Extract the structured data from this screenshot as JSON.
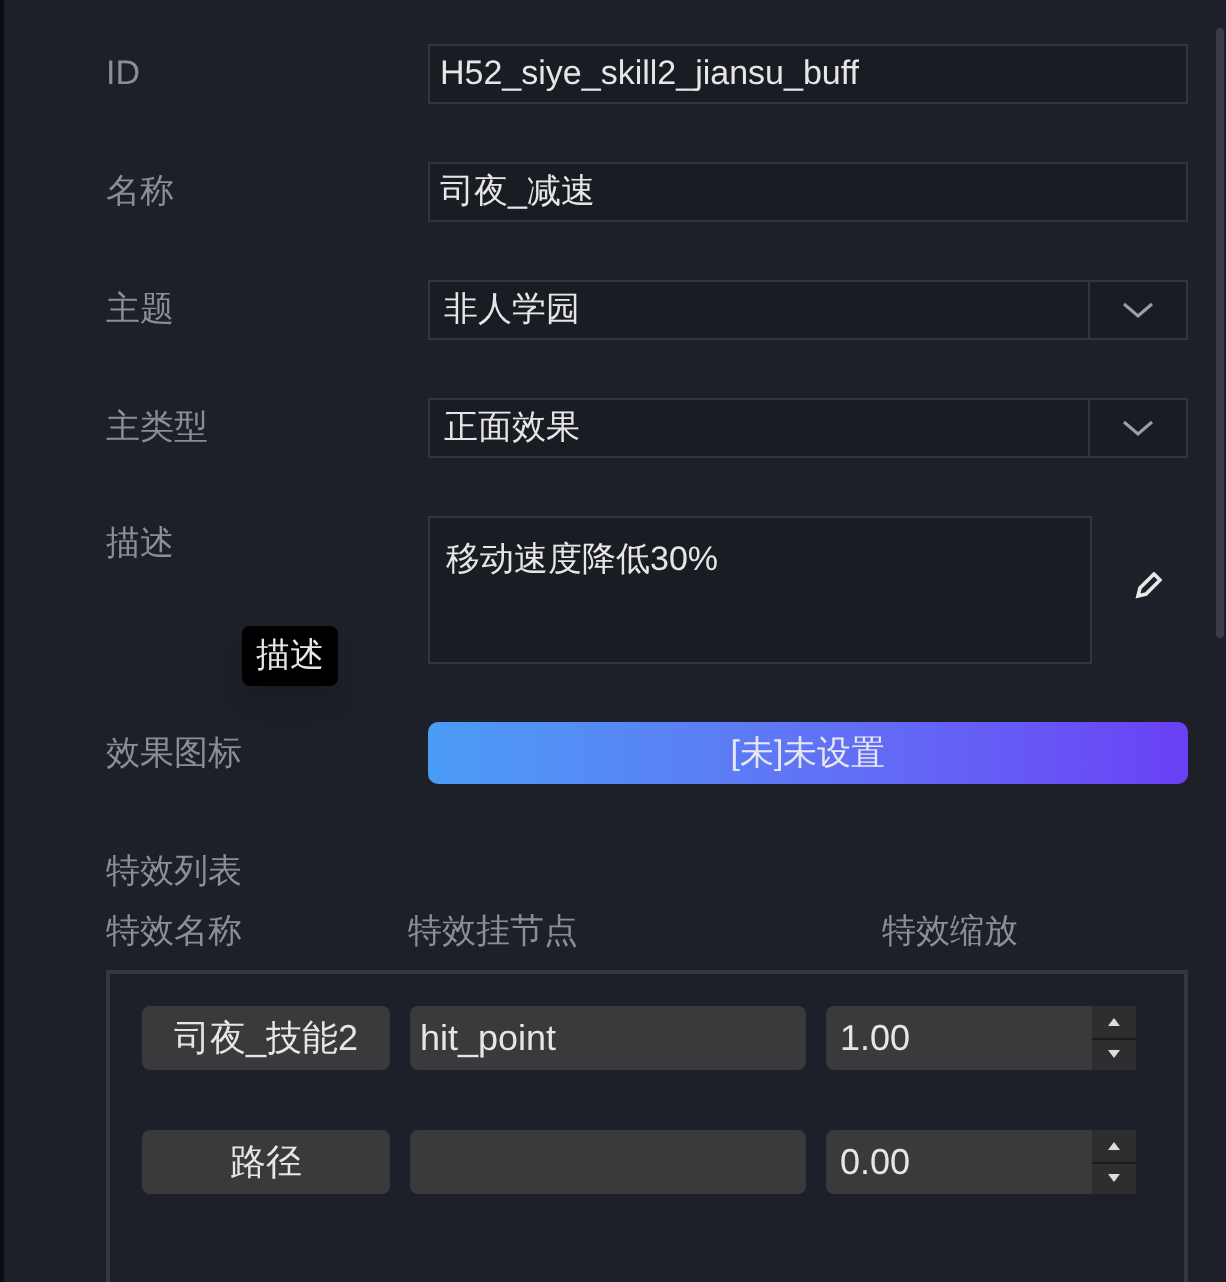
{
  "fields": [
    {
      "kind": "text",
      "label": "ID",
      "value": "H52_siye_skill2_jiansu_buff"
    },
    {
      "kind": "text",
      "label": "名称",
      "value": "司夜_减速"
    },
    {
      "kind": "select",
      "label": "主题",
      "value": "非人学园"
    },
    {
      "kind": "select",
      "label": "主类型",
      "value": "正面效果"
    },
    {
      "kind": "textarea",
      "label": "描述",
      "value": "移动速度降低30%",
      "tooltip": "描述"
    },
    {
      "kind": "picker",
      "label": "效果图标",
      "value": "[未]未设置"
    }
  ],
  "effects": {
    "title": "特效列表",
    "columns": [
      "特效名称",
      "特效挂节点",
      "特效缩放"
    ],
    "rows": [
      {
        "name": "司夜_技能2",
        "node": "hit_point",
        "scale": "1.00"
      },
      {
        "name": "路径",
        "scale": "0.00"
      }
    ]
  }
}
